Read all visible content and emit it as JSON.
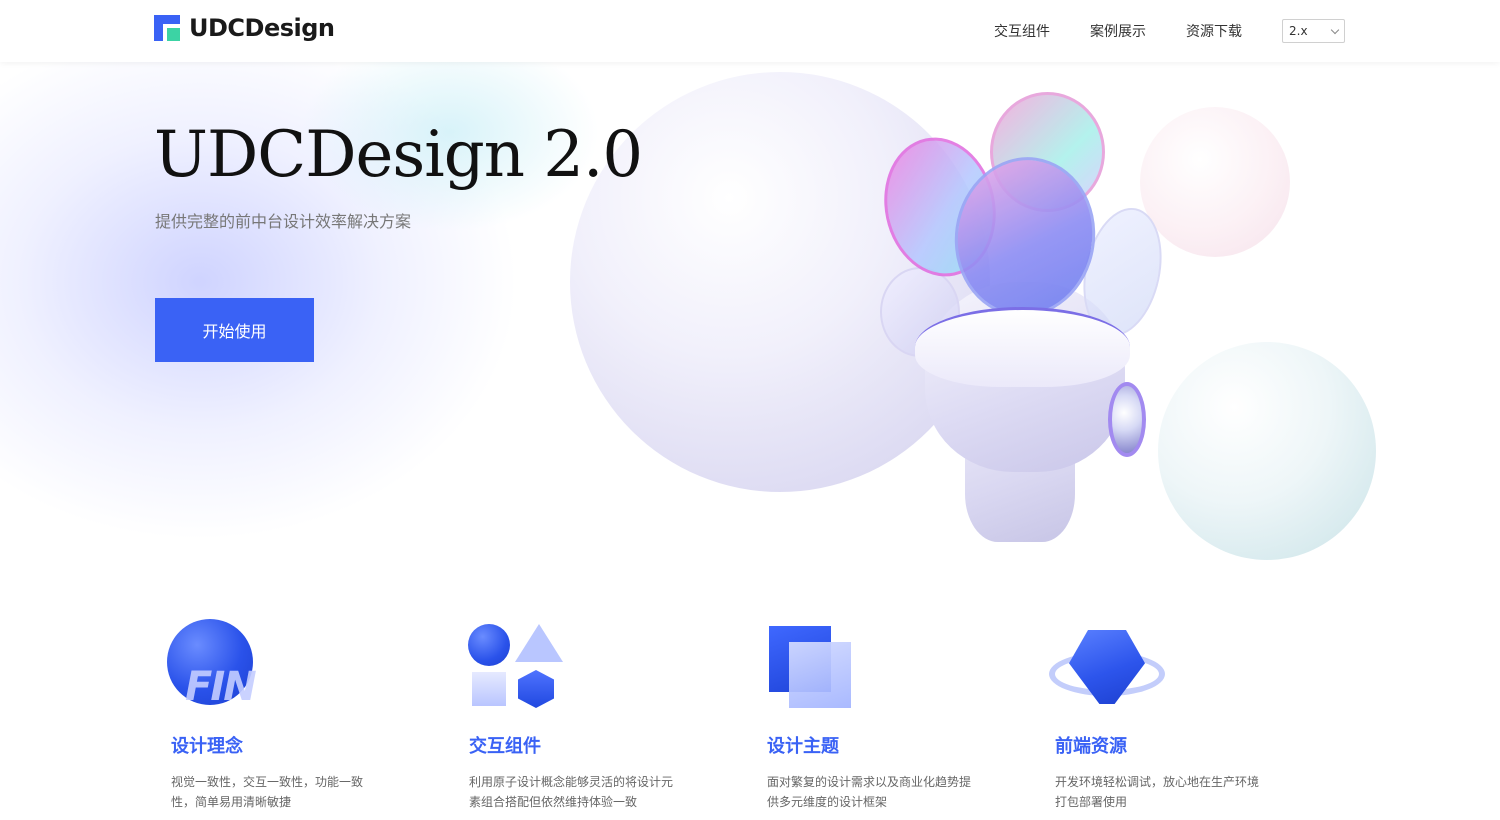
{
  "header": {
    "logo_text": "UDCDesign",
    "nav": [
      "交互组件",
      "案例展示",
      "资源下载"
    ],
    "version": "2.x"
  },
  "hero": {
    "title": "UDCDesign 2.0",
    "subtitle": "提供完整的前中台设计效率解决方案",
    "cta_label": "开始使用"
  },
  "features": [
    {
      "title": "设计理念",
      "desc": "视觉一致性，交互一致性，功能一致性，简单易用清晰敏捷",
      "icon_text": "FIN"
    },
    {
      "title": "交互组件",
      "desc": "利用原子设计概念能够灵活的将设计元素组合搭配但依然维持体验一致"
    },
    {
      "title": "设计主题",
      "desc": "面对繁复的设计需求以及商业化趋势提供多元维度的设计框架"
    },
    {
      "title": "前端资源",
      "desc": "开发环境轻松调试，放心地在生产环境打包部署使用"
    }
  ],
  "colors": {
    "accent": "#3a62f5",
    "logo_secondary": "#3cd3a4"
  }
}
